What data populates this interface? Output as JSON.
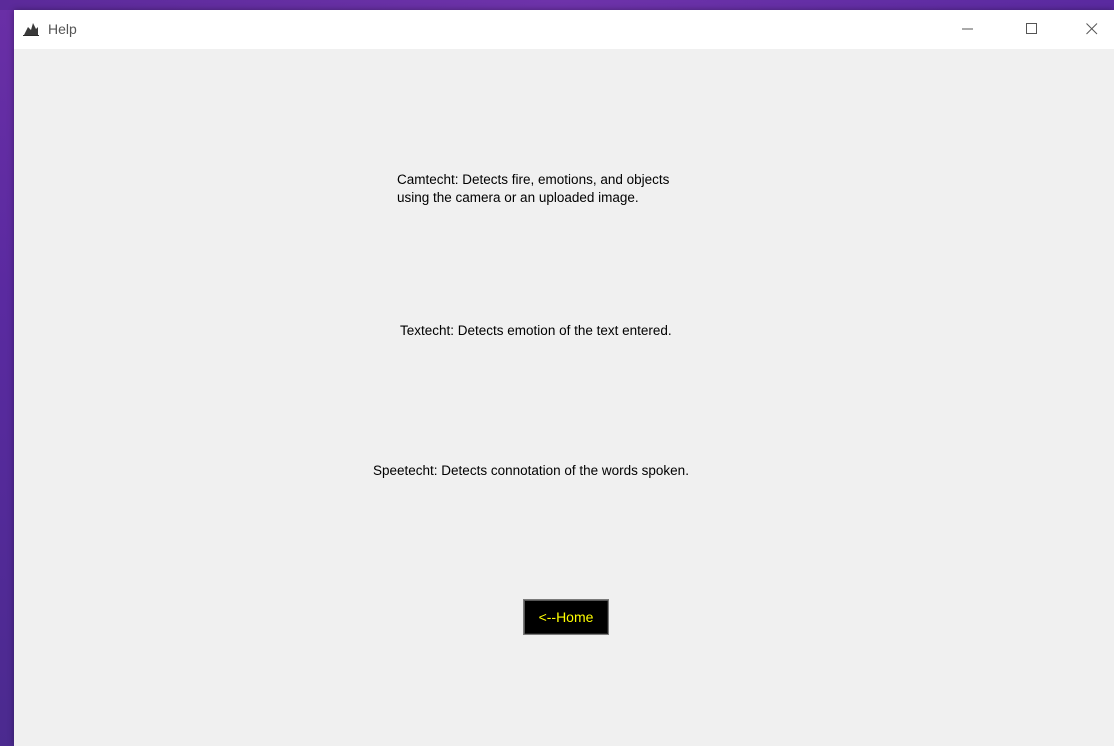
{
  "window": {
    "title": "Help",
    "controls": {
      "minimize": "minimize-icon",
      "maximize": "maximize-icon",
      "close": "close-icon"
    }
  },
  "help": {
    "camtecht": "Camtecht: Detects fire, emotions, and objects\nusing the camera or an uploaded image.",
    "textecht": "Textecht: Detects emotion of the text entered.",
    "speetecht": "Speetecht: Detects connotation of the words spoken."
  },
  "home_button": {
    "label": "<--Home",
    "background": "#000000",
    "text_color": "#ffff00"
  },
  "colors": {
    "desktop": "#6a2fa6",
    "window_bg": "#f0f0f0",
    "titlebar_bg": "#ffffff"
  }
}
